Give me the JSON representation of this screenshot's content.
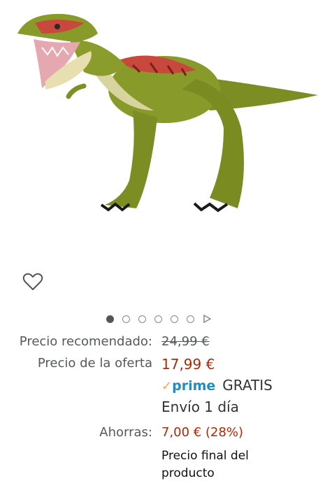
{
  "gallery": {
    "image_alt": "Dinosaurio de juguete verde con rayas rojas",
    "dot_count": 6,
    "active_dot": 0
  },
  "icons": {
    "wishlist": "heart-outline-icon",
    "next": "play-triangle-icon"
  },
  "pricing": {
    "recommended_label": "Precio recomendado:",
    "recommended_value": "24,99 €",
    "offer_label": "Precio de la oferta",
    "offer_value": "17,99 €",
    "prime_check": "✓",
    "prime_label": "prime",
    "shipping": "GRATIS",
    "delivery": "Envío 1 día",
    "savings_label": "Ahorras:",
    "savings_value": "7,00 € (28%)",
    "final_note": "Precio final del producto"
  },
  "colors": {
    "price": "#b12704",
    "prime_blue": "#1f8ebd",
    "prime_check": "#f3a847",
    "label_gray": "#565959"
  }
}
